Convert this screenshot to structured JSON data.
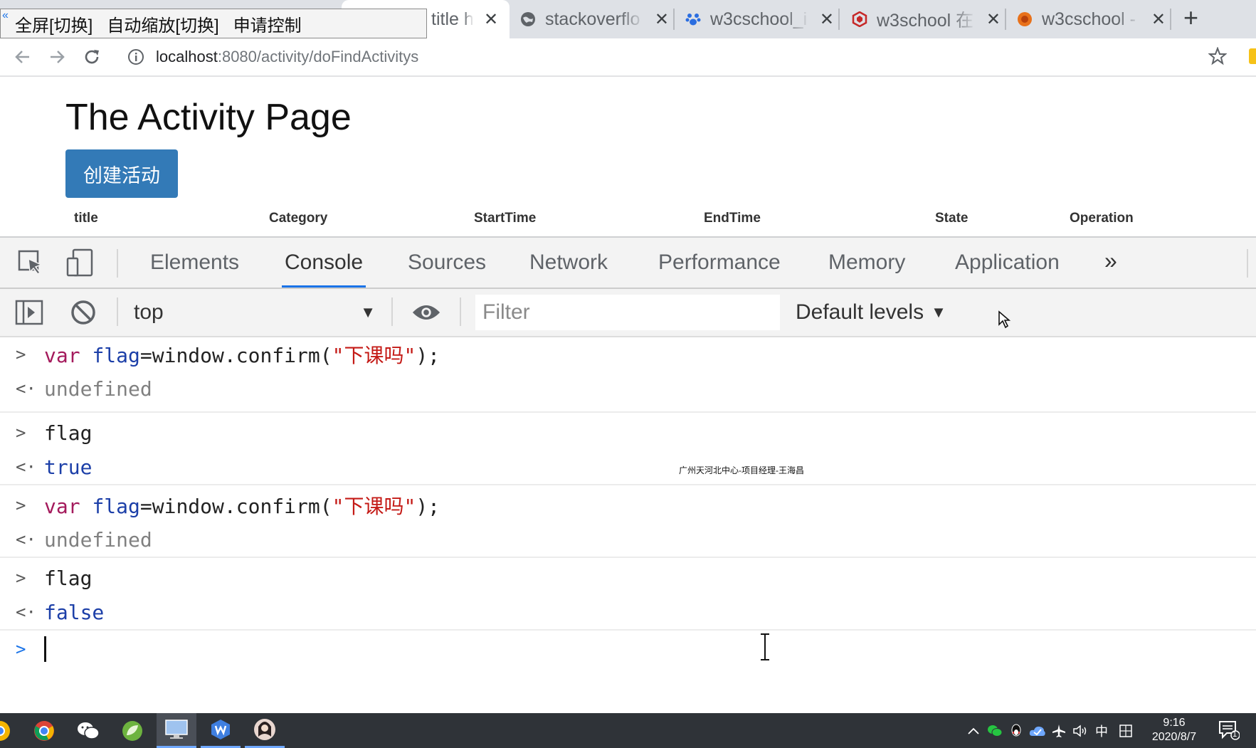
{
  "remote_toolbar": {
    "items": [
      "全屏[切换]",
      "自动缩放[切换]",
      "申请控制"
    ]
  },
  "tabs": [
    {
      "title": "title h",
      "icon": "document-icon",
      "active": true
    },
    {
      "title": "stackoverflo",
      "icon": "globe-icon",
      "active": false
    },
    {
      "title": "w3cschool_i",
      "icon": "paw-icon",
      "active": false
    },
    {
      "title": "w3school 在",
      "icon": "w3school-logo-icon",
      "active": false
    },
    {
      "title": "w3cschool -",
      "icon": "w3cschool-logo-icon",
      "active": false
    }
  ],
  "address_bar": {
    "host": "localhost",
    "path": ":8080/activity/doFindActivitys"
  },
  "page": {
    "title": "The Activity Page",
    "create_button": "创建活动",
    "table_headers": [
      "title",
      "Category",
      "StartTime",
      "EndTime",
      "State",
      "Operation"
    ]
  },
  "devtools": {
    "tabs": [
      "Elements",
      "Console",
      "Sources",
      "Network",
      "Performance",
      "Memory",
      "Application"
    ],
    "active_tab": "Console",
    "context": "top",
    "filter_placeholder": "Filter",
    "levels": "Default levels"
  },
  "console": {
    "entries": [
      {
        "kind": "input",
        "text": "var flag=window.confirm(\"下课吗\");"
      },
      {
        "kind": "output",
        "text": "undefined"
      },
      {
        "kind": "input",
        "text": "flag"
      },
      {
        "kind": "output",
        "text": "true"
      },
      {
        "kind": "input",
        "text": "var flag=window.confirm(\"下课吗\");"
      },
      {
        "kind": "output",
        "text": "undefined"
      },
      {
        "kind": "input",
        "text": "flag"
      },
      {
        "kind": "output",
        "text": "false"
      }
    ],
    "watermark": "广州天河北中心-项目经理-王海昌"
  },
  "taskbar": {
    "apps": [
      "chrome-icon",
      "wechat-icon",
      "spring-icon",
      "remote-desktop-icon",
      "wps-icon",
      "avatar-icon"
    ],
    "tray_icons": [
      "chevron-up-icon",
      "wechat-tray-icon",
      "qq-icon",
      "cloud-icon",
      "airplane-icon",
      "volume-icon",
      "ime-zh-icon",
      "ime-grid-icon"
    ],
    "ime_label": "中",
    "time": "9:16",
    "date": "2020/8/7",
    "notification_count": "1"
  },
  "colors": {
    "accent": "#1a73e8",
    "button_primary": "#337ab7",
    "keyword": "#a41a5c",
    "string": "#c41a16",
    "boolean": "#1c3fa8"
  }
}
